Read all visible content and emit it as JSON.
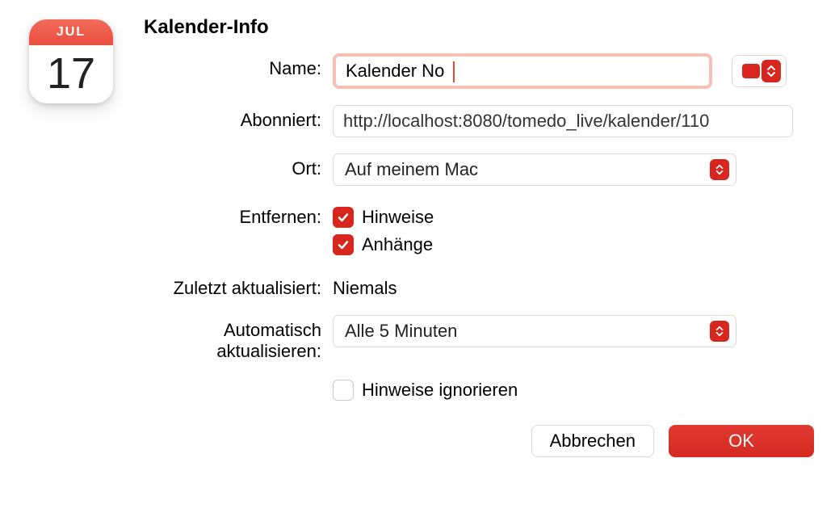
{
  "icon": {
    "month": "JUL",
    "day": "17"
  },
  "section_title": "Kalender-Info",
  "labels": {
    "name": "Name:",
    "subscribed": "Abonniert:",
    "location": "Ort:",
    "remove": "Entfernen:",
    "last_updated": "Zuletzt aktualisiert:",
    "auto_update": "Automatisch aktualisieren:"
  },
  "fields": {
    "name_value": "Kalender No",
    "subscribed_url": "http://localhost:8080/tomedo_live/kalender/110",
    "location_value": "Auf meinem Mac",
    "remove_hints": "Hinweise",
    "remove_attachments": "Anhänge",
    "last_updated_value": "Niemals",
    "auto_update_value": "Alle 5 Minuten",
    "ignore_hints": "Hinweise ignorieren"
  },
  "buttons": {
    "cancel": "Abbrechen",
    "ok": "OK"
  },
  "colors": {
    "accent": "#d6261d"
  }
}
